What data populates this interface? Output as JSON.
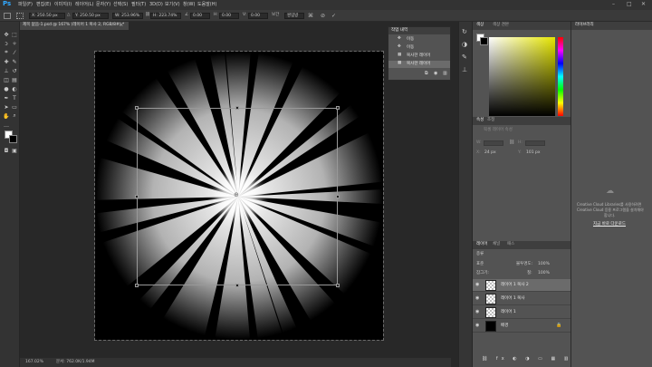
{
  "app": {
    "logo": "Ps"
  },
  "menu": [
    "파일(F)",
    "편집(E)",
    "이미지(I)",
    "레이어(L)",
    "문자(Y)",
    "선택(S)",
    "필터(T)",
    "3D(D)",
    "보기(V)",
    "창(W)",
    "도움말(H)"
  ],
  "options": {
    "x": "X: 250.50 px",
    "y": "Y: 250.50 px",
    "w": "W: 253.96%",
    "h": "H: 223.74%",
    "angle": "0.00",
    "h_skew": "0.00",
    "v_skew": "0.00",
    "interp": "쌍입방",
    "mode": "보간"
  },
  "document": {
    "tab_title": "제목 없음-1.psd @ 167% (레이어 1 복사 2, RGB/8#) *",
    "zoom": "167.02%",
    "doc_info": "문서: 762.0K/1.94M"
  },
  "history": {
    "title": "작업 내역",
    "items": [
      "이동",
      "이동",
      "복사한 레이어",
      "복사한 레이어"
    ]
  },
  "color_panel": {
    "tabs": [
      "색상",
      "색상 견본"
    ]
  },
  "properties_panel": {
    "tabs": [
      "속성",
      "조정"
    ],
    "header": "픽셀 레이어 속성",
    "w_label": "W:",
    "h_label": "H:",
    "x_label": "X:",
    "x_val": "24 px",
    "y_label": "Y:",
    "y_val": "101 px"
  },
  "layers_panel": {
    "tabs": [
      "레이어",
      "채널",
      "패스"
    ],
    "kind": "종류",
    "blend": "표준",
    "opacity_label": "불투명도:",
    "opacity": "100%",
    "lock_label": "잠그기:",
    "fill_label": "칠:",
    "fill": "100%",
    "layers": [
      {
        "name": "레이어 1 복사 2",
        "selected": true
      },
      {
        "name": "레이어 1 복사",
        "selected": false
      },
      {
        "name": "레이어 1",
        "selected": false
      },
      {
        "name": "배경",
        "selected": false
      }
    ]
  },
  "library_panel": {
    "title": "라이브러리",
    "msg1": "Creative Cloud Libraries를 사용하려면",
    "msg2": "Creative Cloud 응용 프로그램을 설치해야",
    "msg3": "합니다.",
    "link": "지금 바로 다운로드"
  },
  "colors": {
    "fg": "#ffffff",
    "bg": "#000000",
    "accent": "#31a8ff"
  }
}
